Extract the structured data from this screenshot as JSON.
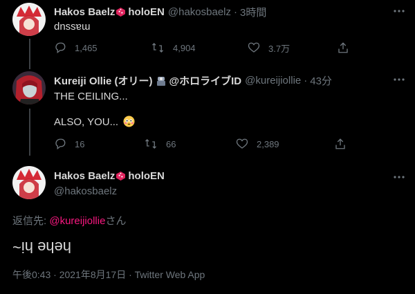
{
  "tweets": [
    {
      "name": "Hakos Baelz",
      "org": "holoEN",
      "handle": "@hakosbaelz",
      "time": "3時間",
      "text": "dnssɐɯ",
      "replies": "1,465",
      "retweets": "4,904",
      "likes": "3.7万"
    },
    {
      "name": "Kureiji Ollie (オリー)",
      "org": "@ホロライブID",
      "handle": "@kureijiollie",
      "time": "43分",
      "line1": "THE CEILING...",
      "line2": "ALSO, YOU...",
      "replies": "16",
      "retweets": "66",
      "likes": "2,389"
    }
  ],
  "main": {
    "name": "Hakos Baelz",
    "org": "holoEN",
    "handle": "@hakosbaelz",
    "reply_prefix": "返信先: ",
    "reply_to": "@kureijiollie",
    "reply_suffix": "さん",
    "text": "hehe hi~",
    "meta": "午後0:43 · 2021年8月17日 · Twitter Web App"
  },
  "separator": "·",
  "colors": {
    "background": "#000000",
    "text": "#d9d9d9",
    "muted": "#6e767d",
    "link": "#f91880",
    "dice": "#e0245e"
  },
  "icons": [
    "reply-icon",
    "retweet-icon",
    "like-icon",
    "share-icon",
    "more-icon",
    "dice-icon",
    "verified-icon",
    "flushed-emoji"
  ]
}
